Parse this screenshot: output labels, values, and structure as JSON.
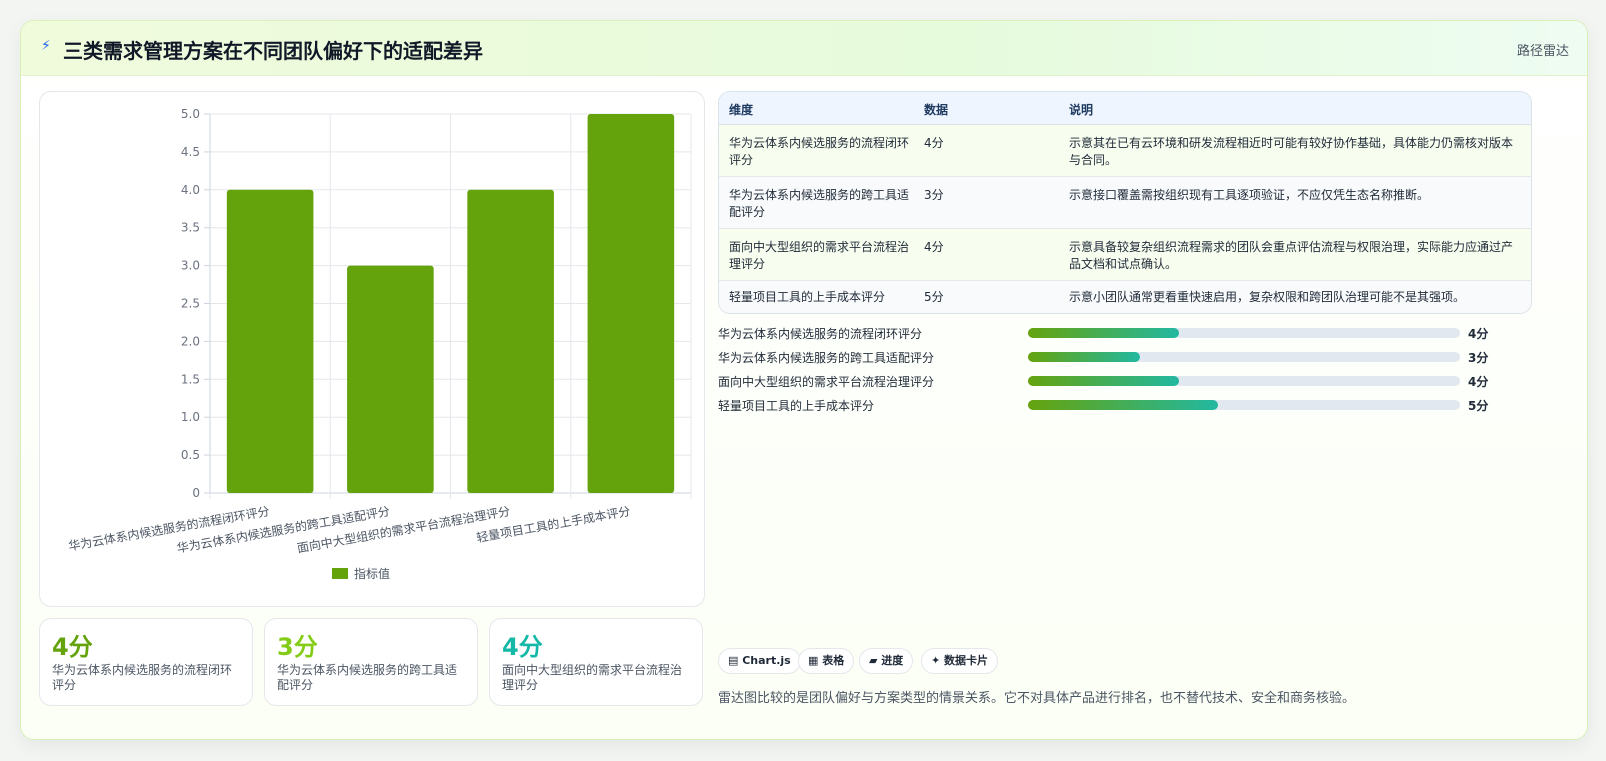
{
  "header": {
    "icon": "lightning-icon",
    "title": "三类需求管理方案在不同团队偏好下的适配差异",
    "tag": "路径雷达"
  },
  "chart_data": {
    "type": "bar",
    "categories": [
      "华为云体系内候选服务的流程闭环评分",
      "华为云体系内候选服务的跨工具适配评分",
      "面向中大型组织的需求平台流程治理评分",
      "轻量项目工具的上手成本评分"
    ],
    "series": [
      {
        "name": "指标值",
        "values": [
          4,
          3,
          4,
          5
        ]
      }
    ],
    "yticks": [
      "0",
      "0.5",
      "1.0",
      "1.5",
      "2.0",
      "2.5",
      "3.0",
      "3.5",
      "4.0",
      "4.5",
      "5.0"
    ],
    "ylim": [
      0,
      5
    ],
    "legend": "bottom",
    "grid": true,
    "color": "#65a30d"
  },
  "stats": [
    {
      "value": "4分",
      "label": "华为云体系内候选服务的流程闭环评分",
      "color": "#65a30d"
    },
    {
      "value": "3分",
      "label": "华为云体系内候选服务的跨工具适配评分",
      "color": "#84cc16"
    },
    {
      "value": "4分",
      "label": "面向中大型组织的需求平台流程治理评分",
      "color": "#14b8a6"
    }
  ],
  "table": {
    "headers": [
      "维度",
      "数据",
      "说明"
    ],
    "rows": [
      {
        "dim": "华为云体系内候选服务的流程闭环评分",
        "data": "4分",
        "desc": "示意其在已有云环境和研发流程相近时可能有较好协作基础，具体能力仍需核对版本与合同。"
      },
      {
        "dim": "华为云体系内候选服务的跨工具适配评分",
        "data": "3分",
        "desc": "示意接口覆盖需按组织现有工具逐项验证，不应仅凭生态名称推断。"
      },
      {
        "dim": "面向中大型组织的需求平台流程治理评分",
        "data": "4分",
        "desc": "示意具备较复杂组织流程需求的团队会重点评估流程与权限治理，实际能力应通过产品文档和试点确认。"
      },
      {
        "dim": "轻量项目工具的上手成本评分",
        "data": "5分",
        "desc": "示意小团队通常更看重快速启用，复杂权限和跨团队治理可能不是其强项。"
      }
    ]
  },
  "progress": [
    {
      "label": "华为云体系内候选服务的流程闭环评分",
      "value": "4分",
      "fraction": 0.35
    },
    {
      "label": "华为云体系内候选服务的跨工具适配评分",
      "value": "3分",
      "fraction": 0.26
    },
    {
      "label": "面向中大型组织的需求平台流程治理评分",
      "value": "4分",
      "fraction": 0.35
    },
    {
      "label": "轻量项目工具的上手成本评分",
      "value": "5分",
      "fraction": 0.44
    }
  ],
  "chips": [
    {
      "icon": "chart-icon",
      "label": "▤ Chart.js"
    },
    {
      "icon": "table-icon",
      "label": "▦ 表格"
    },
    {
      "icon": "progress-icon",
      "label": "▰ 进度"
    },
    {
      "icon": "card-icon",
      "label": "✦ 数据卡片"
    }
  ],
  "note": "雷达图比较的是团队偏好与方案类型的情景关系。它不对具体产品进行排名，也不替代技术、安全和商务核验。"
}
